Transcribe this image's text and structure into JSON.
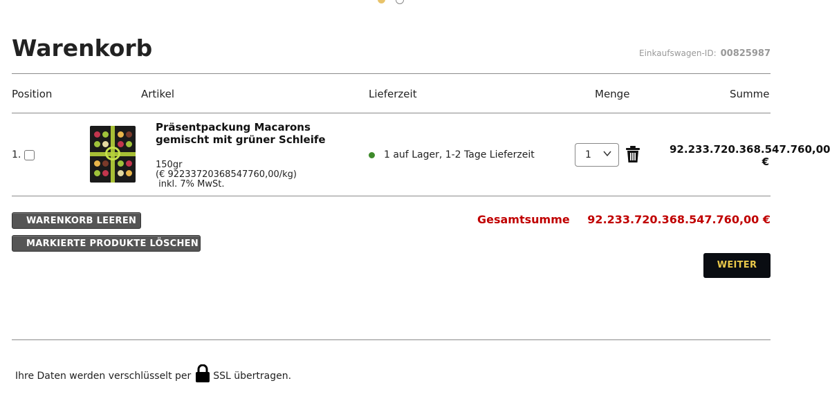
{
  "header": {
    "title": "Warenkorb",
    "cart_id_label": "Einkaufswagen-ID:",
    "cart_id_value": "00825987"
  },
  "table": {
    "columns": [
      "Position",
      "Artikel",
      "Lieferzeit",
      "Menge",
      "Summe"
    ],
    "rows": [
      {
        "position": "1.",
        "product_name": "Präsentpackung Macarons gemischt mit grüner Schleife",
        "weight": "150gr",
        "unit_price": "(€ 92233720368547760,00/kg)",
        "tax": " inkl. 7% MwSt.",
        "stock_status": "1 auf Lager, 1-2 Tage Lieferzeit",
        "quantity": "1",
        "sum_value": "92.233.720.368.547.760,00",
        "sum_currency": "€"
      }
    ]
  },
  "actions": {
    "clear_cart": "WARENKORB LEEREN",
    "delete_marked": "MARKIERTE PRODUKTE LÖSCHEN",
    "next": "WEITER"
  },
  "total": {
    "label": "Gesamtsumme",
    "value": "92.233.720.368.547.760,00 €"
  },
  "footer": {
    "ssl_before": "Ihre Daten werden verschlüsselt per",
    "ssl_after": "SSL übertragen."
  },
  "colors": {
    "accent_red": "#c00000",
    "stock_green": "#3e8a2b",
    "next_button_bg": "#0a0d12",
    "next_button_text": "#e9c84a",
    "grey_button_bg": "#555555"
  },
  "icons": [
    "checkbox-icon",
    "stock-dot-icon",
    "chevron-down-icon",
    "trash-icon",
    "lock-icon"
  ]
}
